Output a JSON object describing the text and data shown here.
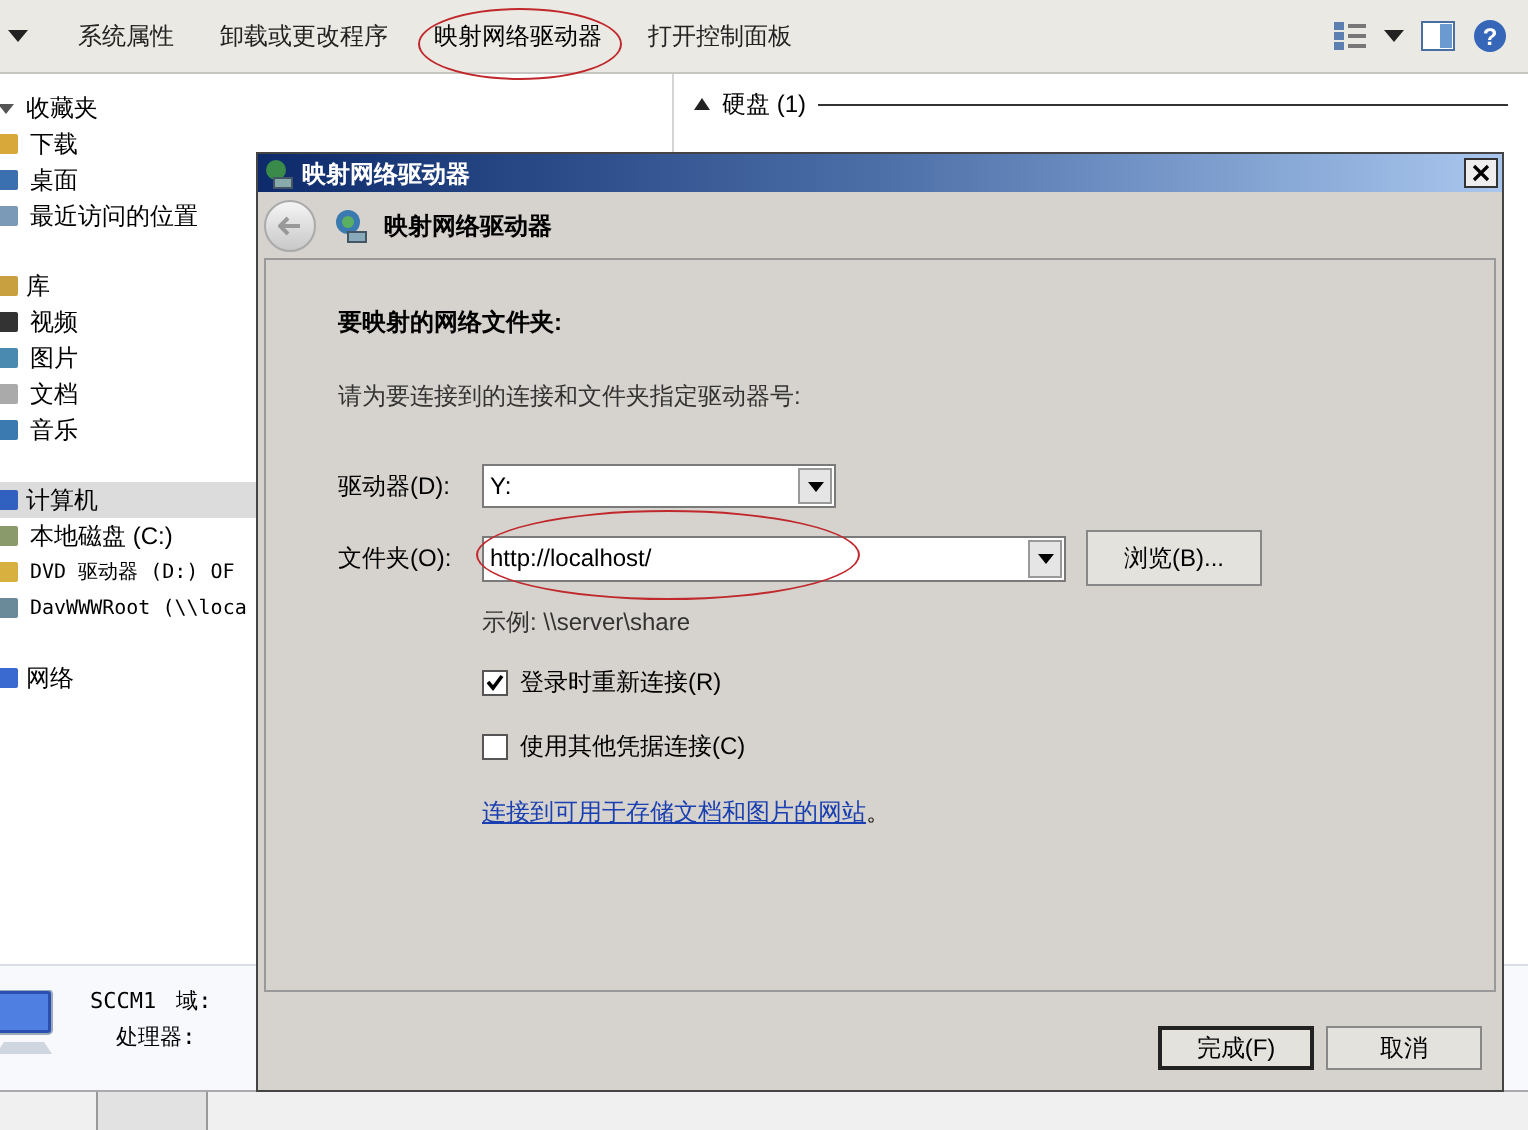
{
  "toolbar": {
    "items": [
      {
        "label": "系统属性"
      },
      {
        "label": "卸载或更改程序"
      },
      {
        "label": "映射网络驱动器",
        "highlighted": true
      },
      {
        "label": "打开控制面板"
      }
    ],
    "help": "?"
  },
  "sidebar": {
    "items": [
      {
        "label": "收藏夹",
        "expanded": true,
        "selected": false,
        "children": [
          {
            "label": "下载",
            "selected": false
          },
          {
            "label": "桌面",
            "selected": false
          },
          {
            "label": "最近访问的位置",
            "selected": false
          }
        ]
      },
      {
        "label": "库",
        "selected": false,
        "children": [
          {
            "label": "视频",
            "selected": false
          },
          {
            "label": "图片",
            "selected": false
          },
          {
            "label": "文档",
            "selected": false
          },
          {
            "label": "音乐",
            "selected": false
          }
        ]
      },
      {
        "label": "计算机",
        "selected": true,
        "children": [
          {
            "label": "本地磁盘 (C:)",
            "selected": false
          },
          {
            "label": "DVD 驱动器 (D:) OF",
            "selected": false
          },
          {
            "label": "DavWWWRoot (\\\\loca",
            "selected": false
          }
        ]
      },
      {
        "label": "网络",
        "selected": false
      }
    ]
  },
  "content": {
    "group_header": "硬盘 (1)",
    "expanded": true
  },
  "details": {
    "name": "SCCM1",
    "labels": [
      "域:",
      "处理器:"
    ]
  },
  "dialog": {
    "title": "映射网络驱动器",
    "header": "映射网络驱动器",
    "heading": "要映射的网络文件夹:",
    "instruction": "请为要连接到的连接和文件夹指定驱动器号:",
    "drive": {
      "label": "驱动器(D):",
      "value": "Y:"
    },
    "folder": {
      "label": "文件夹(O):",
      "value": "http://localhost/",
      "highlighted": true
    },
    "browse_button": "浏览(B)...",
    "example": "示例: \\\\server\\share",
    "checkboxes": [
      {
        "label": "登录时重新连接(R)",
        "checked": true
      },
      {
        "label": "使用其他凭据连接(C)",
        "checked": false
      }
    ],
    "link": "连接到可用于存储文档和图片的网站",
    "link_suffix": "。",
    "buttons": [
      {
        "label": "完成(F)",
        "default": true
      },
      {
        "label": "取消",
        "default": false
      }
    ]
  }
}
